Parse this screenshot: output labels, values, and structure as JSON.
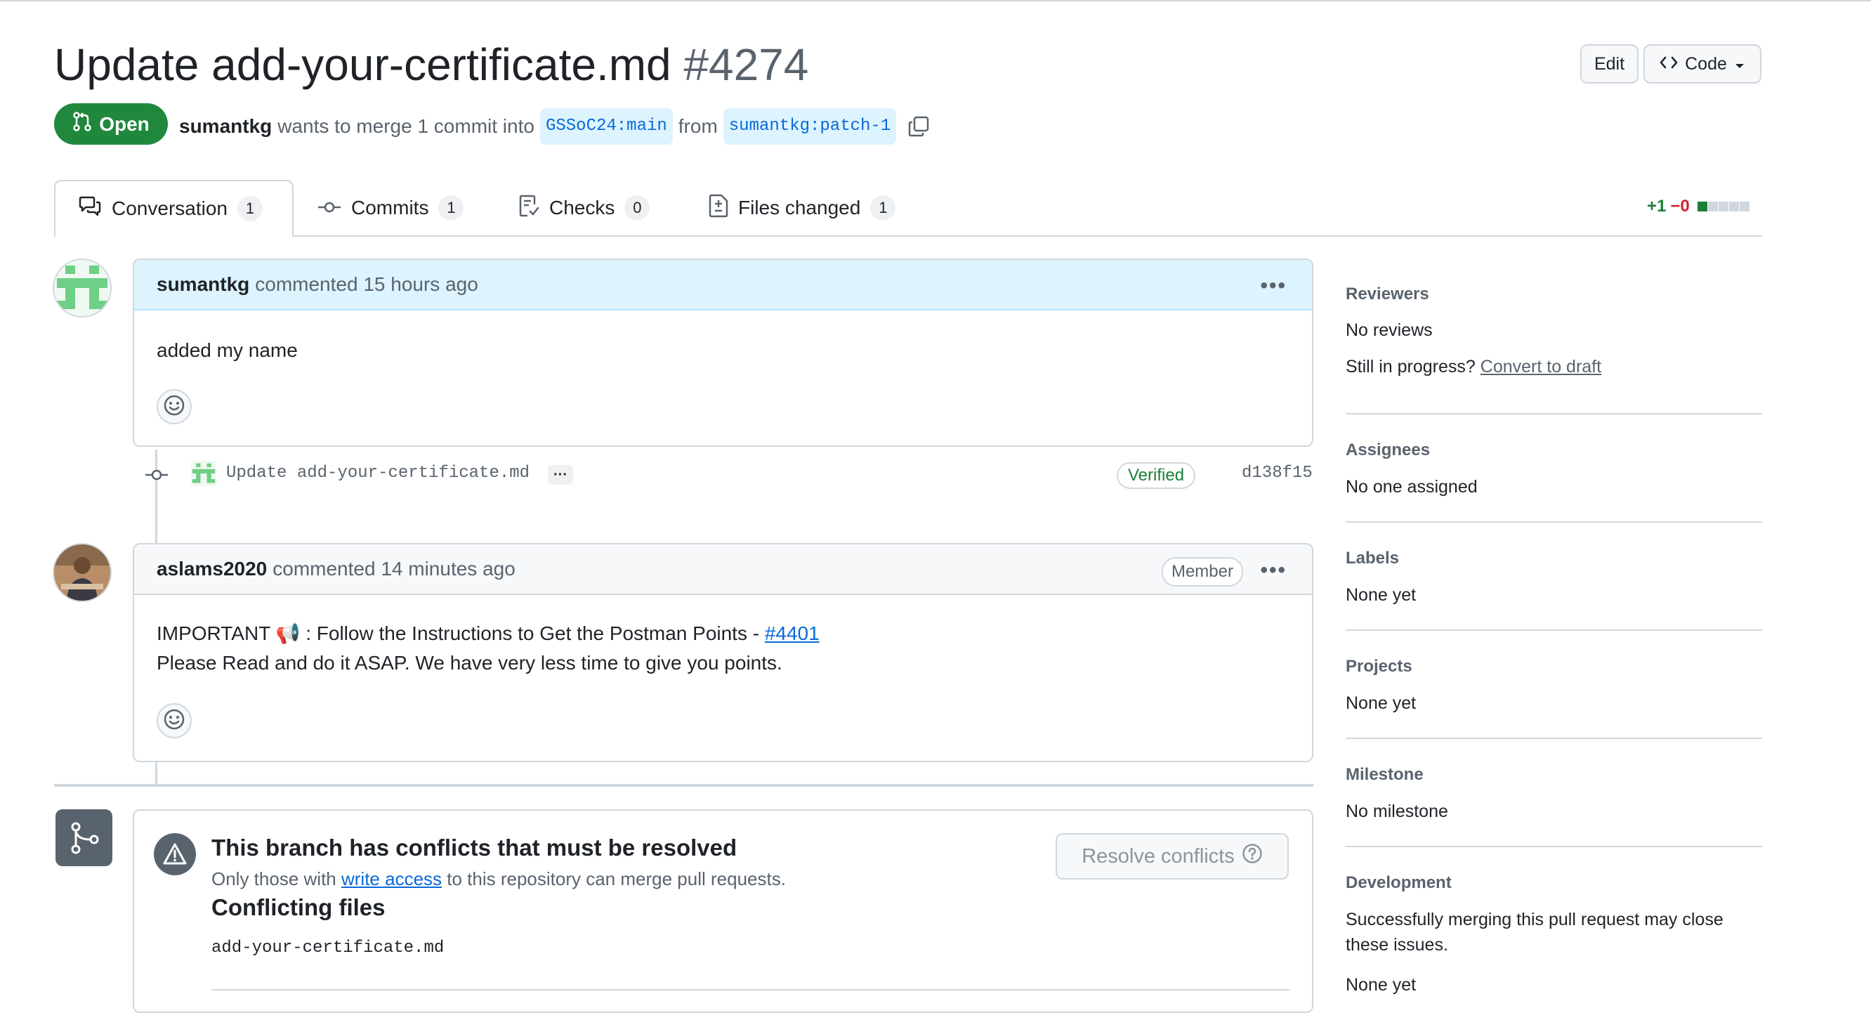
{
  "header": {
    "title": "Update add-your-certificate.md",
    "number": "#4274",
    "edit_label": "Edit",
    "code_label": "Code",
    "state": "Open",
    "author": "sumantkg",
    "merge_text": "wants to merge 1 commit into",
    "base_branch": "GSSoC24:main",
    "from_text": "from",
    "head_branch": "sumantkg:patch-1"
  },
  "tabs": [
    {
      "label": "Conversation",
      "count": "1"
    },
    {
      "label": "Commits",
      "count": "1"
    },
    {
      "label": "Checks",
      "count": "0"
    },
    {
      "label": "Files changed",
      "count": "1"
    }
  ],
  "diffstat": {
    "additions": "+1",
    "deletions": "−0"
  },
  "comments": [
    {
      "author": "sumantkg",
      "meta": "commented 15 hours ago",
      "body_line1": "added my name"
    },
    {
      "author": "aslams2020",
      "meta": "commented 14 minutes ago",
      "badge": "Member",
      "body_prefix": "IMPORTANT 📢 : Follow the Instructions to Get the Postman Points - ",
      "body_link": "#4401",
      "body_line2": "Please Read and do it ASAP. We have very less time to give you points."
    }
  ],
  "commit": {
    "message": "Update add-your-certificate.md",
    "verified": "Verified",
    "sha": "d138f15"
  },
  "merge_box": {
    "title": "This branch has conflicts that must be resolved",
    "sub_prefix": "Only those with",
    "sub_link": "write access",
    "sub_suffix": "to this repository can merge pull requests.",
    "files_title": "Conflicting files",
    "file": "add-your-certificate.md",
    "resolve_label": "Resolve conflicts"
  },
  "sidebar": {
    "reviewers": {
      "heading": "Reviewers",
      "value": "No reviews",
      "draft_prefix": "Still in progress?",
      "draft_link": "Convert to draft"
    },
    "assignees": {
      "heading": "Assignees",
      "value": "No one assigned"
    },
    "labels": {
      "heading": "Labels",
      "value": "None yet"
    },
    "projects": {
      "heading": "Projects",
      "value": "None yet"
    },
    "milestone": {
      "heading": "Milestone",
      "value": "No milestone"
    },
    "development": {
      "heading": "Development",
      "text_line1": "Successfully merging this pull request may close",
      "text_line2": "these issues.",
      "value": "None yet"
    }
  }
}
